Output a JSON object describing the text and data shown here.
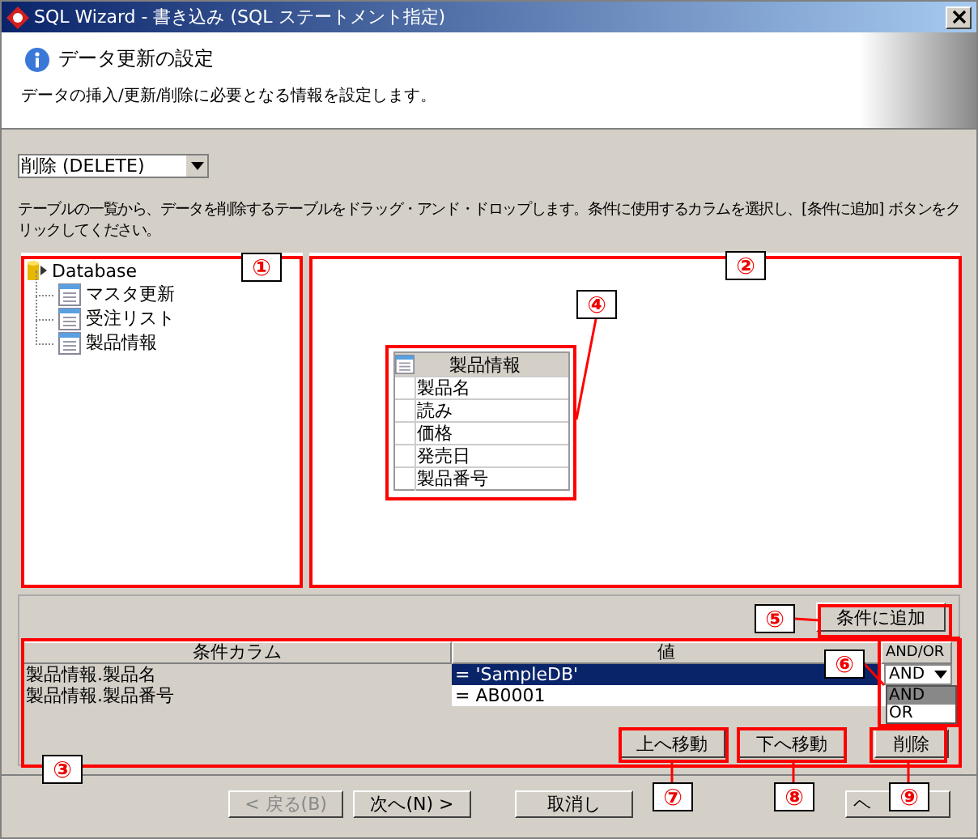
{
  "window": {
    "title": "SQL Wizard - 書き込み (SQL ステートメント指定)"
  },
  "header": {
    "title": "データ更新の設定",
    "description": "データの挿入/更新/削除に必要となる情報を設定します。"
  },
  "operation_select": {
    "value": "削除 (DELETE)"
  },
  "instructions": "テーブルの一覧から、データを削除するテーブルをドラッグ・アンド・ドロップします。条件に使用するカラムを選択し、[条件に追加] ボタンをクリックしてください。",
  "tree": {
    "root": "Database",
    "children": [
      {
        "label": "マスタ更新"
      },
      {
        "label": "受注リスト"
      },
      {
        "label": "製品情報"
      }
    ]
  },
  "canvas_table": {
    "title": "製品情報",
    "columns": [
      "製品名",
      "読み",
      "価格",
      "発売日",
      "製品番号"
    ]
  },
  "add_condition_button": "条件に追加",
  "conditions": {
    "columns": [
      "条件カラム",
      "値",
      "AND/OR"
    ],
    "rows": [
      {
        "column": "製品情報.製品名",
        "value": "= 'SampleDB'",
        "selected": true
      },
      {
        "column": "製品情報.製品番号",
        "value": "= AB0001",
        "selected": false
      }
    ],
    "and_or_value": "AND",
    "and_or_options": [
      {
        "label": "AND",
        "selected": true
      },
      {
        "label": "OR",
        "selected": false
      }
    ]
  },
  "row_buttons": [
    "上へ移動",
    "下へ移動",
    "削除"
  ],
  "nav_buttons": [
    {
      "label": "< 戻る(B)",
      "disabled": true
    },
    {
      "label": "次へ(N) >",
      "disabled": false
    },
    {
      "label": "取消し",
      "disabled": false
    },
    {
      "label": "ヘ",
      "disabled": false
    }
  ],
  "callouts": [
    "①",
    "②",
    "③",
    "④",
    "⑤",
    "⑥",
    "⑦",
    "⑧",
    "⑨"
  ]
}
